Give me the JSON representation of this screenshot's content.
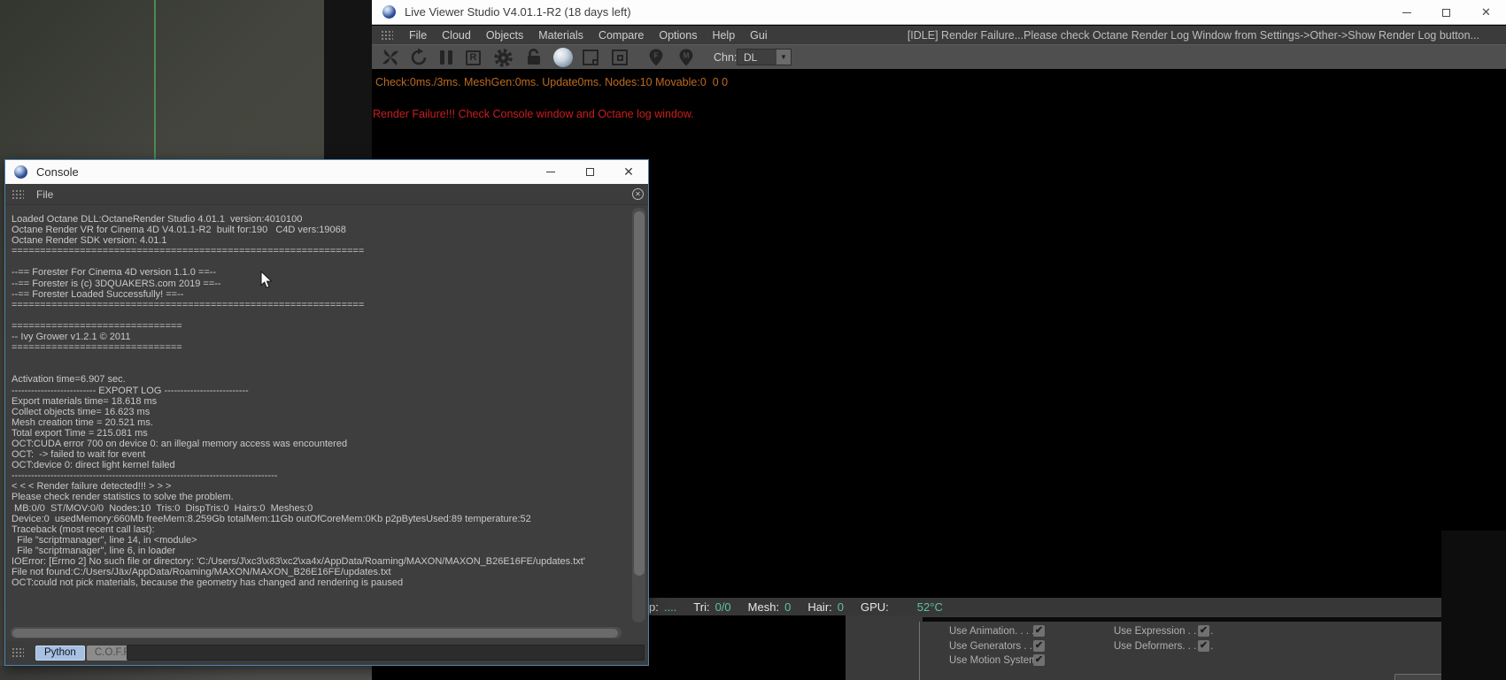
{
  "app": {
    "title": "Live Viewer Studio V4.01.1-R2 (18 days left)",
    "menu_items": [
      {
        "label": "File"
      },
      {
        "label": "Cloud"
      },
      {
        "label": "Objects"
      },
      {
        "label": "Materials"
      },
      {
        "label": "Compare"
      },
      {
        "label": "Options"
      },
      {
        "label": "Help"
      },
      {
        "label": "Gui"
      }
    ],
    "status_message": "[IDLE] Render Failure...Please check Octane Render Log Window from Settings->Other->Show Render Log button...",
    "toolbar": {
      "r_letter": "R",
      "pin_f": "F",
      "pin_m": "M",
      "channel_label": "Chn:",
      "channel_value": "DL",
      "dropdown_arrow": "▼"
    },
    "viewport": {
      "check_line": "Check:0ms./3ms. MeshGen:0ms. Update0ms. Nodes:10 Movable:0  0 0",
      "error_line": "Render Failure!!! Check Console window and Octane log window."
    },
    "statusbar_items": [
      {
        "label": "p:",
        "value": "...."
      },
      {
        "label": "Tri:",
        "value": "0/0"
      },
      {
        "label": "Mesh:",
        "value": "0"
      },
      {
        "label": "Hair:",
        "value": "0"
      },
      {
        "label": "GPU:",
        "value": "52°C"
      }
    ],
    "settings_panel": {
      "left_column": [
        {
          "label": "Use Animation. . . . .",
          "mark": "✔"
        },
        {
          "label": "Use Generators . . . .",
          "mark": "✔"
        },
        {
          "label": "Use Motion System",
          "mark": "✔"
        }
      ],
      "right_column": [
        {
          "label": "Use Expression . . . . .",
          "mark": "✔"
        },
        {
          "label": "Use Deformers. . . . . .",
          "mark": "✔"
        }
      ]
    },
    "window_controls": {
      "minimize": "–",
      "maximize": "",
      "close": "✕"
    }
  },
  "console": {
    "title": "Console",
    "file_menu": "File",
    "close_log_glyph": "✕",
    "log_lines": [
      {
        "text": "Loaded Octane DLL:OctaneRender Studio 4.01.1  version:4010100"
      },
      {
        "text": "Octane Render VR for Cinema 4D V4.01.1-R2  built for:190   C4D vers:19068"
      },
      {
        "text": "Octane Render SDK version: 4.01.1"
      },
      {
        "text": "=============================================================="
      },
      {
        "text": ""
      },
      {
        "text": "--== Forester For Cinema 4D version 1.1.0 ==--"
      },
      {
        "text": "--== Forester is (c) 3DQUAKERS.com 2019 ==--"
      },
      {
        "text": "--== Forester Loaded Successfully! ==--"
      },
      {
        "text": "=============================================================="
      },
      {
        "text": ""
      },
      {
        "text": "=============================="
      },
      {
        "text": "-- Ivy Grower v1.2.1 © 2011"
      },
      {
        "text": "=============================="
      },
      {
        "text": ""
      },
      {
        "text": ""
      },
      {
        "text": "Activation time=6.907 sec."
      },
      {
        "text": "-------------------------- EXPORT LOG --------------------------"
      },
      {
        "text": "Export materials time= 18.618 ms"
      },
      {
        "text": "Collect objects time= 16.623 ms"
      },
      {
        "text": "Mesh creation time = 20.521 ms."
      },
      {
        "text": "Total export Time = 215.081 ms"
      },
      {
        "text": "OCT:CUDA error 700 on device 0: an illegal memory access was encountered"
      },
      {
        "text": "OCT:  -> failed to wait for event"
      },
      {
        "text": "OCT:device 0: direct light kernel failed"
      },
      {
        "text": "----------------------------------------------------------------------------------"
      },
      {
        "text": "< < < Render failure detected!!! > > >"
      },
      {
        "text": "Please check render statistics to solve the problem."
      },
      {
        "text": " MB:0/0  ST/MOV:0/0  Nodes:10  Tris:0  DispTris:0  Hairs:0  Meshes:0"
      },
      {
        "text": "Device:0  usedMemory:660Mb freeMem:8.259Gb totalMem:11Gb outOfCoreMem:0Kb p2pBytesUsed:89 temperature:52"
      },
      {
        "text": "Traceback (most recent call last):"
      },
      {
        "text": "  File \"scriptmanager\", line 14, in <module>"
      },
      {
        "text": "  File \"scriptmanager\", line 6, in loader"
      },
      {
        "text": "IOError: [Errno 2] No such file or directory: 'C:/Users/J\\xc3\\x83\\xc2\\xa4x/AppData/Roaming/MAXON/MAXON_B26E16FE/updates.txt'"
      },
      {
        "text": "File not found:C:/Users/Jäx/AppData/Roaming/MAXON/MAXON_B26E16FE/updates.txt"
      },
      {
        "text": "OCT:could not pick materials, because the geometry has changed and rendering is paused"
      }
    ],
    "tabs": {
      "python": "Python",
      "coffee": "C.O.F.F.E.E."
    },
    "input_value": "",
    "window_controls": {
      "minimize": "–",
      "close": "✕"
    }
  }
}
